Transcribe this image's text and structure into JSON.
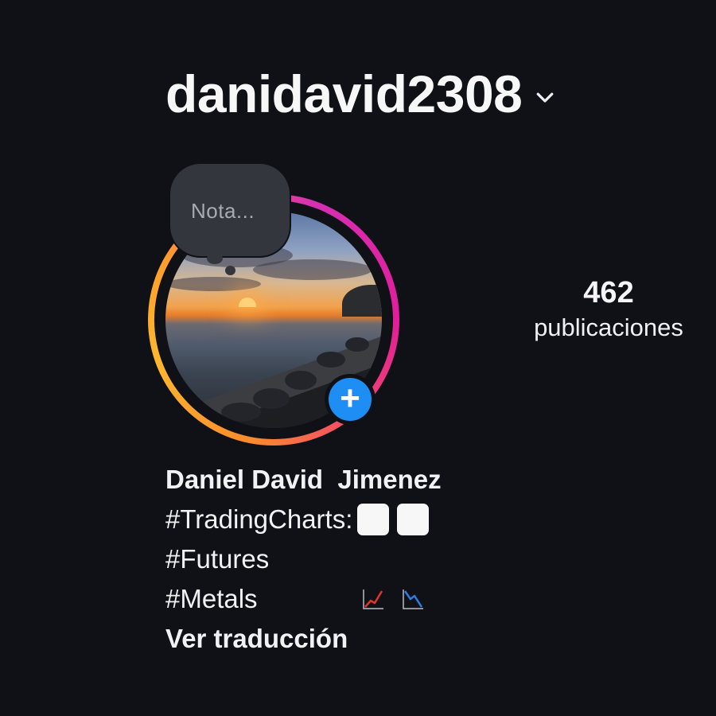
{
  "profile": {
    "username": "danidavid2308",
    "note_placeholder": "Nota...",
    "add_icon": "plus-icon",
    "stats": {
      "posts_count": "462",
      "posts_label": "publicaciones"
    },
    "bio": {
      "name": "Daniel David  Jimenez",
      "line1": "#TradingCharts:",
      "line2": "#Futures",
      "line3": "#Metals",
      "translate_link": "Ver traducción"
    }
  },
  "icons": {
    "chevron": "chevron-down-icon",
    "chart_up": "chart-increasing-icon",
    "chart_down": "chart-decreasing-icon"
  },
  "colors": {
    "background": "#0f1116",
    "accent_blue": "#1e8ef5",
    "ring_pink": "#d62fb3",
    "ring_orange": "#fdb72e",
    "note_bg": "#33363d"
  }
}
